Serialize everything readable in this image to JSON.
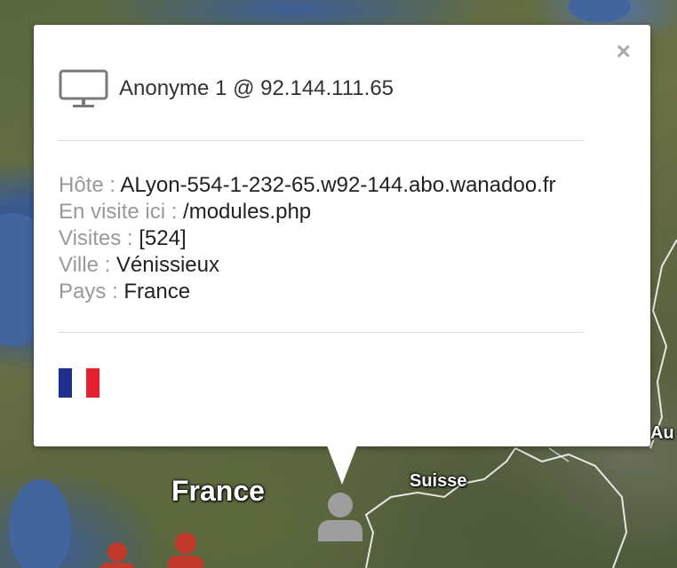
{
  "map": {
    "labels": {
      "france": "France",
      "suisse": "Suisse",
      "partial_right": "Au"
    }
  },
  "popup": {
    "title": "Anonyme 1 @ 92.144.111.65",
    "close_label": "×",
    "device_icon": "monitor-icon",
    "fields": [
      {
        "key": "Hôte : ",
        "value": "ALyon-554-1-232-65.w92-144.abo.wanadoo.fr"
      },
      {
        "key": "En visite ici : ",
        "value": "/modules.php"
      },
      {
        "key": "Visites : ",
        "value": "[524]"
      },
      {
        "key": "Ville : ",
        "value": "Vénissieux"
      },
      {
        "key": "Pays : ",
        "value": "France"
      }
    ],
    "flag": {
      "country": "France",
      "colors": [
        "#1f2f8f",
        "#ffffff",
        "#e4202e"
      ]
    }
  },
  "markers": {
    "selected_color": "#9e9e9e",
    "other_color": "#c0392b"
  }
}
